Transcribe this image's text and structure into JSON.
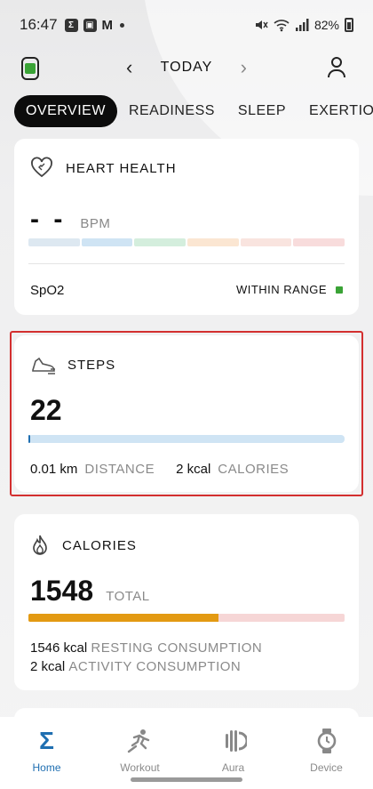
{
  "status_bar": {
    "time": "16:47",
    "battery": "82%",
    "icons": [
      "sigma-icon",
      "image-icon",
      "gmail-icon",
      "dot-icon",
      "mute-icon",
      "wifi-icon",
      "signal-icon",
      "battery-icon"
    ]
  },
  "header": {
    "title": "TODAY",
    "icons": [
      "watch-icon",
      "chevron-left-icon",
      "chevron-right-icon",
      "profile-icon"
    ]
  },
  "tabs": [
    {
      "label": "OVERVIEW",
      "active": true
    },
    {
      "label": "READINESS",
      "active": false
    },
    {
      "label": "SLEEP",
      "active": false
    },
    {
      "label": "EXERTION",
      "active": false
    }
  ],
  "heart_health": {
    "title": "HEART HEALTH",
    "value": "- -",
    "unit": "BPM",
    "zone_colors": [
      "#dde8f1",
      "#cfe4f4",
      "#d4eedd",
      "#fbe6d2",
      "#f9e4df",
      "#f8dcdc"
    ],
    "spo2_label": "SpO2",
    "spo2_status": "WITHIN RANGE",
    "status_color": "#3aa336"
  },
  "steps": {
    "title": "STEPS",
    "value": "22",
    "progress_fraction": 0.004,
    "distance_value": "0.01 km",
    "distance_label": "DISTANCE",
    "calories_value": "2 kcal",
    "calories_label": "CALORIES"
  },
  "calories": {
    "title": "CALORIES",
    "value": "1548",
    "total_label": "TOTAL",
    "resting_fraction": 0.6,
    "resting_value": "1546 kcal",
    "resting_label": "RESTING CONSUMPTION",
    "activity_value": "2 kcal",
    "activity_label": "ACTIVITY CONSUMPTION"
  },
  "bottom_nav": [
    {
      "label": "Home",
      "icon": "sigma-icon",
      "active": true
    },
    {
      "label": "Workout",
      "icon": "runner-icon",
      "active": false
    },
    {
      "label": "Aura",
      "icon": "aura-icon",
      "active": false
    },
    {
      "label": "Device",
      "icon": "watch-icon",
      "active": false
    }
  ],
  "colors": {
    "accent": "#1f6fb1",
    "calorie_bar": "#e39a12",
    "highlight_border": "#d32f2f"
  }
}
